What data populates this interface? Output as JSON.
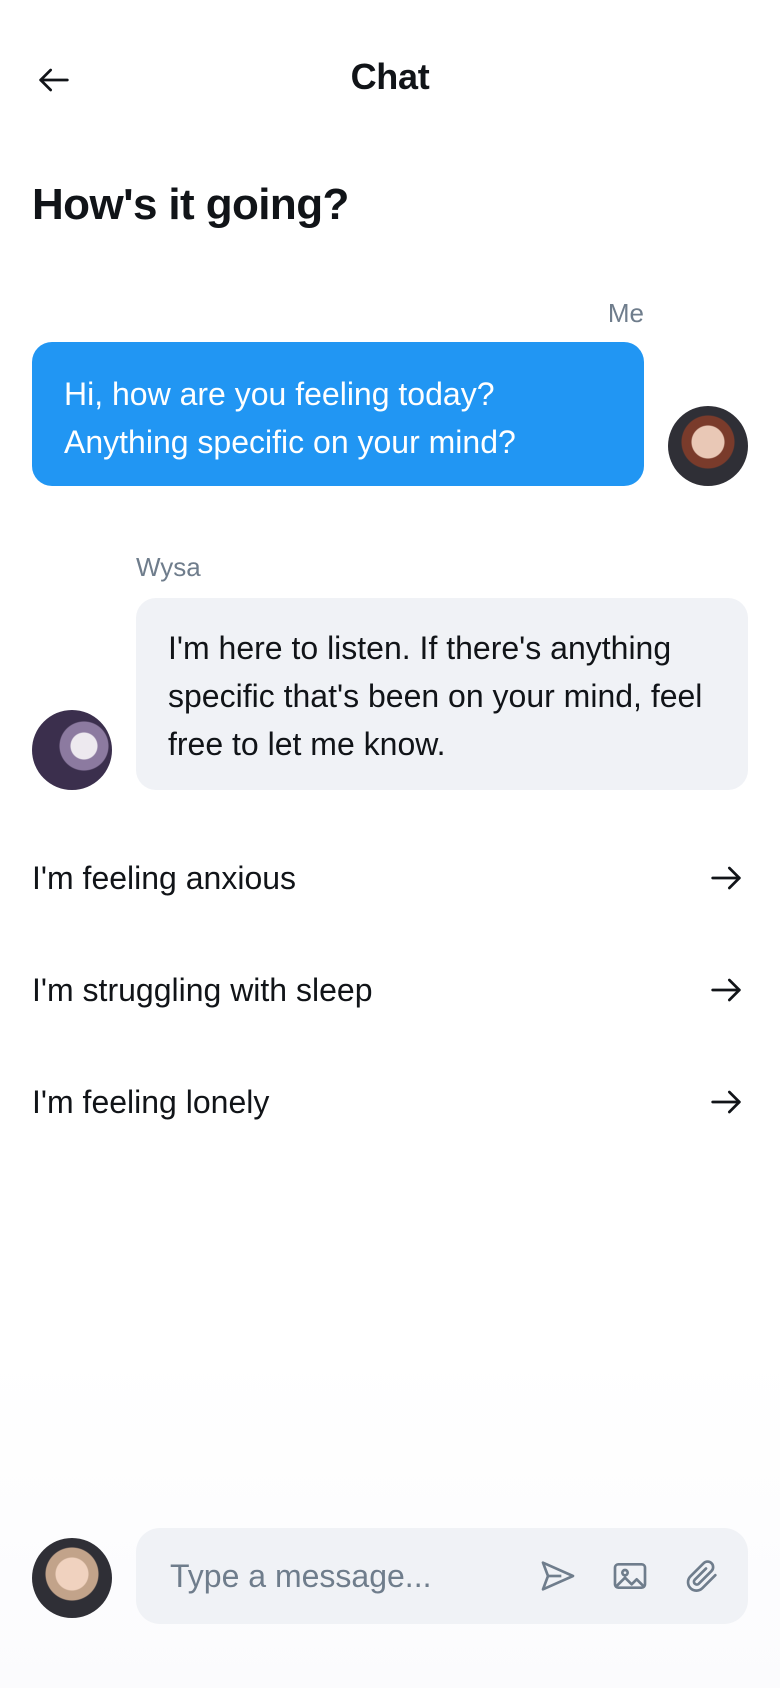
{
  "header": {
    "title": "Chat",
    "back_icon": "arrow-left-icon"
  },
  "main": {
    "heading": "How's it going?"
  },
  "messages": [
    {
      "sender": "Me",
      "text": "Hi, how are you feeling today? Anything specific on your mind?",
      "bubble_color": "#2196F3",
      "text_color": "#FFFFFF"
    },
    {
      "sender": "Wysa",
      "text": "I'm here to listen. If there's anything specific that's been on your mind, feel free to let me know.",
      "bubble_color": "#F0F2F6",
      "text_color": "#111418"
    }
  ],
  "suggestions": [
    {
      "text": "I'm feeling anxious",
      "icon": "arrow-right-icon"
    },
    {
      "text": "I'm struggling with sleep",
      "icon": "arrow-right-icon"
    },
    {
      "text": "I'm feeling lonely",
      "icon": "arrow-right-icon"
    }
  ],
  "composer": {
    "placeholder": "Type a message...",
    "send_icon": "send-icon",
    "image_icon": "image-icon",
    "attach_icon": "paperclip-icon",
    "background": "#F0F2F6"
  },
  "colors": {
    "accent": "#2196F3",
    "muted_text": "#6F7D8C",
    "primary_text": "#111418"
  }
}
